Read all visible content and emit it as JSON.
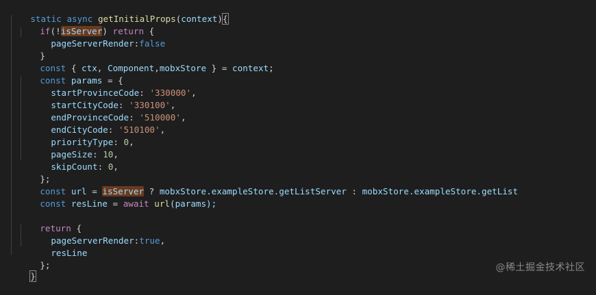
{
  "code": {
    "l1": {
      "a": "static",
      "b": "async",
      "c": "getInitialProps",
      "d": "(",
      "e": "context",
      "f": ")",
      "g": "{"
    },
    "l2": {
      "a": "if",
      "b": "(!",
      "c": "isServer",
      "d": ")",
      "e": "return",
      "f": "{"
    },
    "l3": {
      "a": "pageServerRender",
      "b": ":",
      "c": "false"
    },
    "l4": {
      "a": "}"
    },
    "l5": {
      "a": "const",
      "b": "{",
      "c": "ctx",
      "d": ",",
      "e": "Component",
      "f": ",",
      "g": "mobxStore",
      "h": "}",
      "i": "=",
      "j": "context",
      "k": ";"
    },
    "l6": {
      "a": "const",
      "b": "params",
      "c": "=",
      "d": "{"
    },
    "l7": {
      "a": "startProvinceCode",
      "b": ":",
      "c": "'330000'",
      "d": ","
    },
    "l8": {
      "a": "startCityCode",
      "b": ":",
      "c": "'330100'",
      "d": ","
    },
    "l9": {
      "a": "endProvinceCode",
      "b": ":",
      "c": "'510000'",
      "d": ","
    },
    "l10": {
      "a": "endCityCode",
      "b": ":",
      "c": "'510100'",
      "d": ","
    },
    "l11": {
      "a": "priorityType",
      "b": ":",
      "c": "0",
      "d": ","
    },
    "l12": {
      "a": "pageSize",
      "b": ":",
      "c": "10",
      "d": ","
    },
    "l13": {
      "a": "skipCount",
      "b": ":",
      "c": "0",
      "d": ","
    },
    "l14": {
      "a": "};"
    },
    "l15": {
      "a": "const",
      "b": "url",
      "c": "=",
      "d": "isServer",
      "e": "?",
      "f": "mobxStore",
      "g": ".exampleStore.getListServer",
      "h": ":",
      "i": "mobxStore",
      "j": ".exampleStore.getList"
    },
    "l16": {
      "a": "const",
      "b": "resLine",
      "c": "=",
      "d": "await",
      "e": "url",
      "f": "(params);"
    },
    "l18": {
      "a": "return",
      "b": "{"
    },
    "l19": {
      "a": "pageServerRender",
      "b": ":",
      "c": "true",
      "d": ","
    },
    "l20": {
      "a": "resLine"
    },
    "l21": {
      "a": "};"
    },
    "l22": {
      "a": "}"
    }
  },
  "watermark": "@稀土掘金技术社区",
  "colors": {
    "background": "#1e1e1e",
    "keyword": "#569cd6",
    "control": "#c586c0",
    "function": "#dcdcaa",
    "variable": "#9cdcfe",
    "string": "#ce9178",
    "number": "#b5cea8",
    "class": "#4ec9b0",
    "highlight": "#6b3a1e"
  }
}
